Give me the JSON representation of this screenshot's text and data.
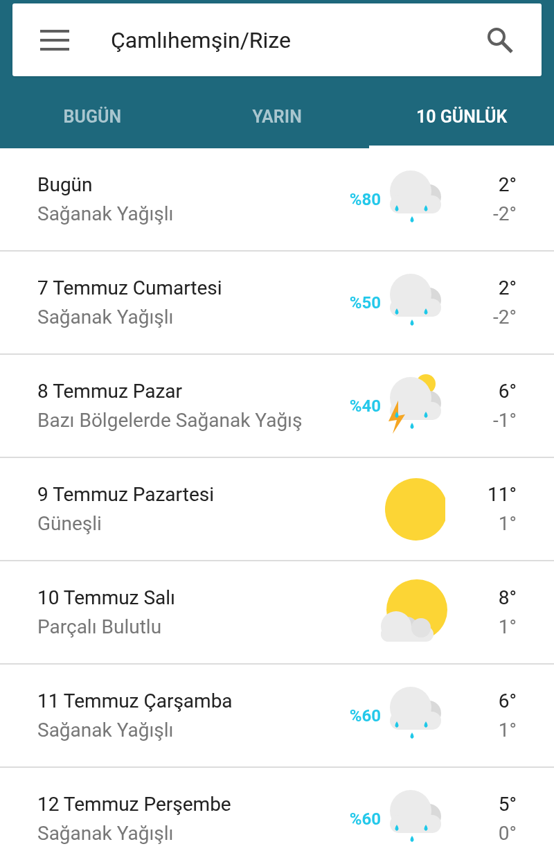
{
  "search": {
    "value": "Çamlıhemşin/Rize"
  },
  "tabs": [
    {
      "label": "BUGÜN",
      "selected": false
    },
    {
      "label": "YARIN",
      "selected": false
    },
    {
      "label": "10 GÜNLÜK",
      "selected": true
    }
  ],
  "days": [
    {
      "title": "Bugün",
      "condition": "Sağanak Yağışlı",
      "chance": "%80",
      "kind": "rain",
      "high": "2°",
      "low": "-2°"
    },
    {
      "title": "7 Temmuz Cumartesi",
      "condition": "Sağanak Yağışlı",
      "chance": "%50",
      "kind": "rain",
      "high": "2°",
      "low": "-2°"
    },
    {
      "title": "8 Temmuz Pazar",
      "condition": "Bazı Bölgelerde Sağanak Yağış",
      "chance": "%40",
      "kind": "storm",
      "high": "6°",
      "low": "-1°"
    },
    {
      "title": "9 Temmuz Pazartesi",
      "condition": "Güneşli",
      "kind": "sun",
      "high": "11°",
      "low": "1°"
    },
    {
      "title": "10 Temmuz Salı",
      "condition": "Parçalı Bulutlu",
      "kind": "partly",
      "high": "8°",
      "low": "1°"
    },
    {
      "title": "11 Temmuz Çarşamba",
      "condition": "Sağanak Yağışlı",
      "chance": "%60",
      "kind": "rain",
      "high": "6°",
      "low": "1°"
    },
    {
      "title": "12 Temmuz Perşembe",
      "condition": "Sağanak Yağışlı",
      "chance": "%60",
      "kind": "rain",
      "high": "5°",
      "low": "0°"
    }
  ]
}
